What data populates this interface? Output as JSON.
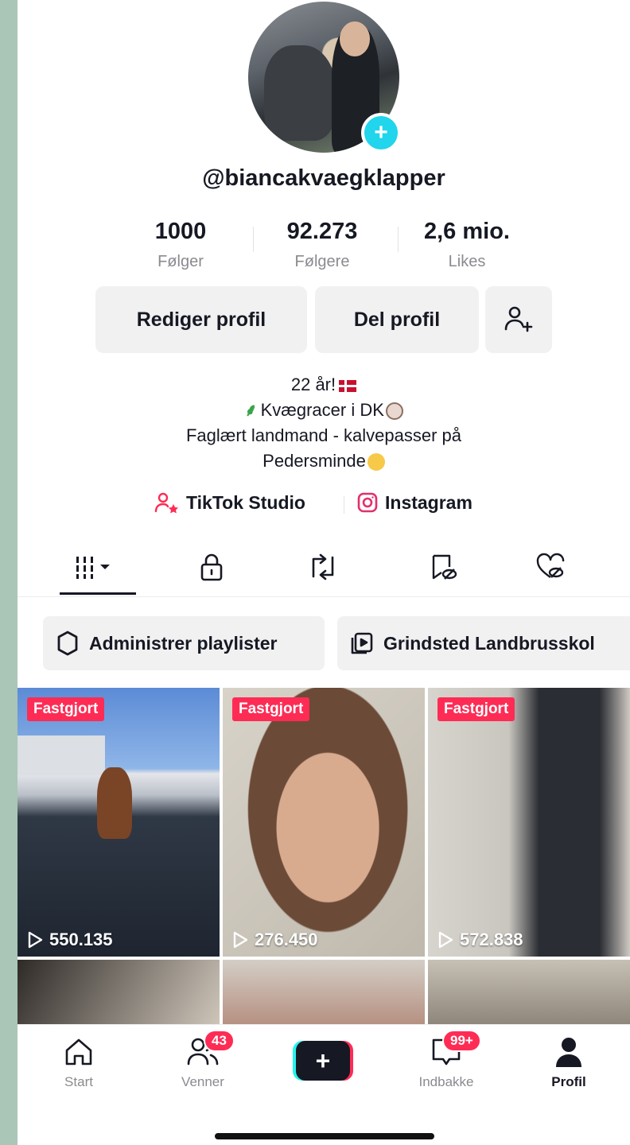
{
  "profile": {
    "username": "@biancakvaegklapper"
  },
  "stats": [
    {
      "value": "1000",
      "label": "Følger"
    },
    {
      "value": "92.273",
      "label": "Følgere"
    },
    {
      "value": "2,6 mio.",
      "label": "Likes"
    }
  ],
  "actions": {
    "edit_label": "Rediger profil",
    "share_label": "Del profil"
  },
  "bio": {
    "line1": "22 år!",
    "line2": "Kvægracer i DK",
    "line3": "Faglært landmand - kalvepasser på",
    "line4": "Pedersminde"
  },
  "links": {
    "studio": "TikTok Studio",
    "instagram": "Instagram"
  },
  "playlists": [
    {
      "label": "Administrer playlister"
    },
    {
      "label": "Grindsted Landbrusskol"
    }
  ],
  "videos": [
    {
      "pinned_label": "Fastgjort",
      "views": "550.135"
    },
    {
      "pinned_label": "Fastgjort",
      "views": "276.450"
    },
    {
      "pinned_label": "Fastgjort",
      "views": "572.838"
    }
  ],
  "nav": {
    "home": "Start",
    "friends": "Venner",
    "friends_badge": "43",
    "inbox": "Indbakke",
    "inbox_badge": "99+",
    "profile": "Profil"
  },
  "colors": {
    "accent": "#fe2c55",
    "cyan": "#25f4ee",
    "avatar_badge": "#20d5ec"
  }
}
